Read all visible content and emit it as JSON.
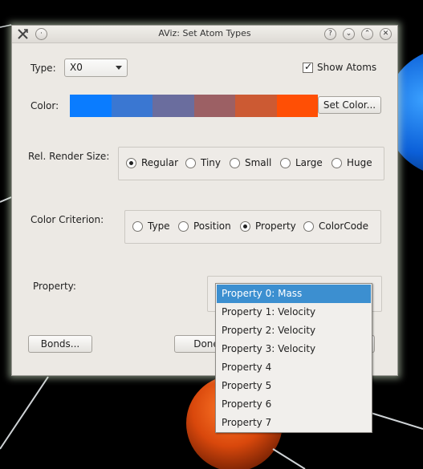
{
  "window": {
    "title": "AViz: Set Atom Types",
    "help_btn": "?",
    "min_btn": "⌄",
    "max_btn": "⌃",
    "close_btn": "✕",
    "shade_btn": "·"
  },
  "type": {
    "label": "Type:",
    "value": "X0"
  },
  "show_atoms": {
    "label": "Show Atoms",
    "checked": true
  },
  "color": {
    "label": "Color:",
    "swatches": [
      "#0a7cff",
      "#3a77d2",
      "#6a6d9e",
      "#9c6064",
      "#cc5a33",
      "#ff4f05"
    ],
    "set_button": "Set Color..."
  },
  "render_size": {
    "label": "Rel. Render Size:",
    "options": [
      "Regular",
      "Tiny",
      "Small",
      "Large",
      "Huge"
    ],
    "selected": "Regular"
  },
  "color_criterion": {
    "label": "Color Criterion:",
    "options": [
      "Type",
      "Position",
      "Property",
      "ColorCode"
    ],
    "selected": "Property"
  },
  "property": {
    "label": "Property:",
    "options": [
      "Property 0: Mass",
      "Property 1: Velocity",
      "Property 2: Velocity",
      "Property 3: Velocity",
      "Property 4",
      "Property 5",
      "Property 6",
      "Property 7"
    ],
    "selected_index": 0
  },
  "buttons": {
    "bonds": "Bonds...",
    "done": "Done"
  }
}
